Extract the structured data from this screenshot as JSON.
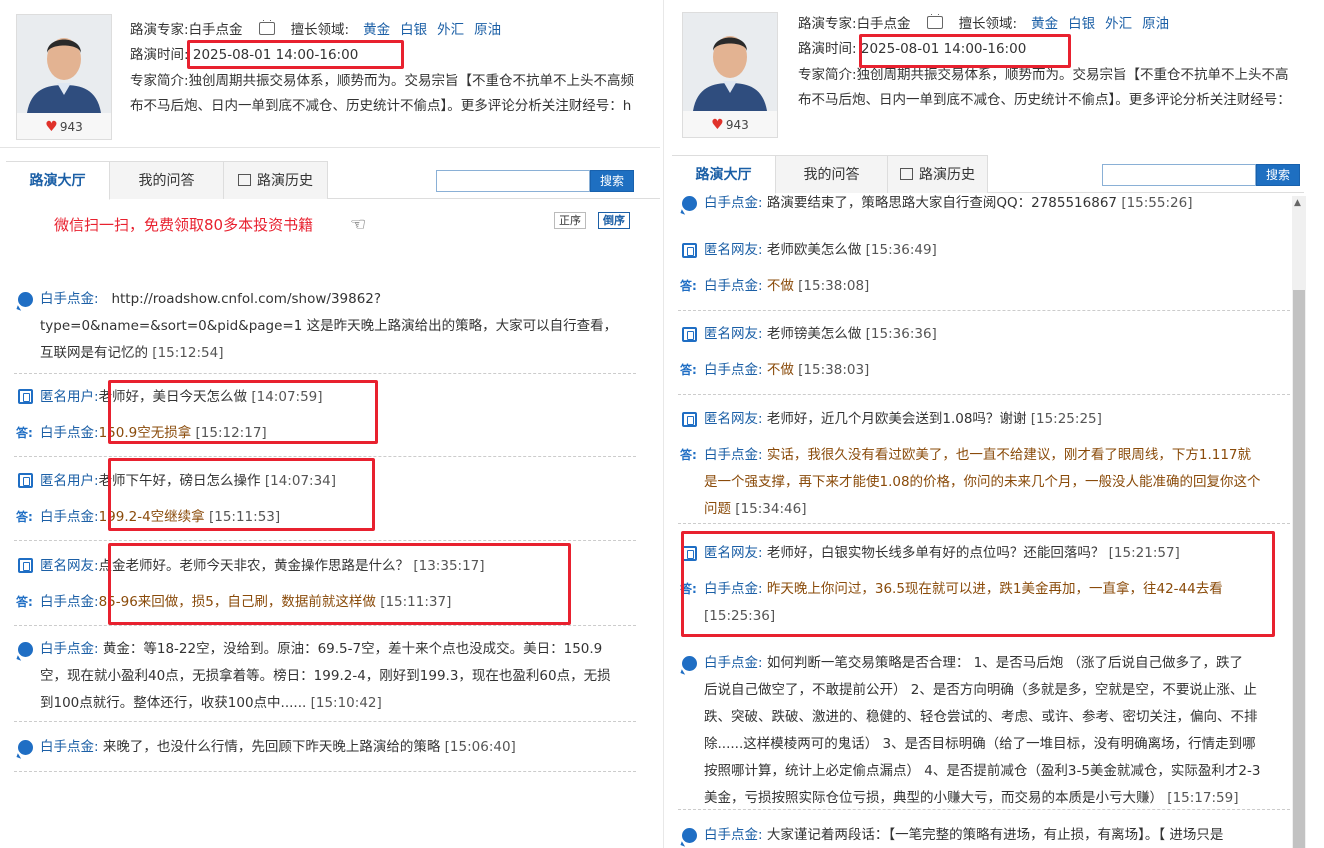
{
  "left": {
    "profile": {
      "expert_label": "路演专家:",
      "expert_name": "白手点金",
      "field_label": "擅长领域:",
      "fields": [
        "黄金",
        "白银",
        "外汇",
        "原油"
      ],
      "time_label": "路演时间:",
      "time_value": "2025-08-01 14:00-16:00",
      "intro_label": "专家简介:",
      "intro_line1": "独创周期共振交易体系，顺势而为。交易宗旨【不重仓不抗单不上头不高频",
      "intro_line2": "布不马后炮、日内一单到底不减仓、历史统计不偷点】。更多评论分析关注财经号：h",
      "likes": "943"
    },
    "tabs": [
      "路演大厅",
      "我的问答",
      "路演历史"
    ],
    "search_button": "搜索",
    "promo": "微信扫一扫，免费领取80多本投资书籍",
    "sort": [
      "正序",
      "倒序"
    ],
    "items": [
      {
        "type": "post",
        "name": "白手点金:",
        "text": "http://roadshow.cnfol.com/show/39862?",
        "text2": "type=0&name=&sort=0&pid&page=1 这是昨天晚上路演给出的策略，大家可以自行查看，",
        "text3": "互联网是有记忆的",
        "time": "[15:12:54]"
      },
      {
        "type": "qa",
        "qname": "匿名用户:",
        "q": "老师好，美日今天怎么做",
        "qtime": "[14:07:59]",
        "aname": "白手点金:",
        "a": "150.9空无损拿",
        "atime": "[15:12:17]"
      },
      {
        "type": "qa",
        "qname": "匿名用户:",
        "q": "老师下午好，磅日怎么操作",
        "qtime": "[14:07:34]",
        "aname": "白手点金:",
        "a": "199.2-4空继续拿",
        "atime": "[15:11:53]"
      },
      {
        "type": "qa",
        "qname": "匿名网友:",
        "q": "点金老师好。老师今天非农，黄金操作思路是什么？",
        "qtime": "[13:35:17]",
        "aname": "白手点金:",
        "a": "85-96来回做，损5，自己刷，数据前就这样做",
        "atime": "[15:11:37]"
      },
      {
        "type": "post",
        "name": "白手点金:",
        "text": "黄金：等18-22空，没给到。原油：69.5-7空，差十来个点也没成交。美日：150.9",
        "text2": "空，现在就小盈利40点，无损拿着等。榜日：199.2-4，刚好到199.3，现在也盈利60点，无损",
        "text3": "到100点就行。整体还行，收获100点中......",
        "time": "[15:10:42]"
      },
      {
        "type": "post",
        "name": "白手点金:",
        "text": "来晚了，也没什么行情，先回顾下昨天晚上路演给的策略",
        "time": "[15:06:40]"
      }
    ]
  },
  "right": {
    "profile": {
      "expert_label": "路演专家:",
      "expert_name": "白手点金",
      "field_label": "擅长领域:",
      "fields": [
        "黄金",
        "白银",
        "外汇",
        "原油"
      ],
      "time_label": "路演时间:",
      "time_value": "2025-08-01 14:00-16:00",
      "intro_label": "专家简介:",
      "intro_line1": "独创周期共振交易体系，顺势而为。交易宗旨【不重仓不抗单不上头不高",
      "intro_line2": "布不马后炮、日内一单到底不减仓、历史统计不偷点】。更多评论分析关注财经号：",
      "likes": "943"
    },
    "tabs": [
      "路演大厅",
      "我的问答",
      "路演历史"
    ],
    "search_button": "搜索",
    "items": [
      {
        "type": "post",
        "name": "白手点金:",
        "text": "路演要结束了，策略思路大家自行查阅QQ：2785516867",
        "time": "[15:55:26]"
      },
      {
        "type": "qa",
        "qname": "匿名网友:",
        "q": "老师欧美怎么做",
        "qtime": "[15:36:49]",
        "aname": "白手点金:",
        "a": "不做",
        "atime": "[15:38:08]"
      },
      {
        "type": "qa",
        "qname": "匿名网友:",
        "q": "老师镑美怎么做",
        "qtime": "[15:36:36]",
        "aname": "白手点金:",
        "a": "不做",
        "atime": "[15:38:03]"
      },
      {
        "type": "qa",
        "qname": "匿名网友:",
        "q": "老师好，近几个月欧美会送到1.08吗？谢谢",
        "qtime": "[15:25:25]",
        "aname": "白手点金:",
        "a": "实话，我很久没有看过欧美了，也一直不给建议，刚才看了眼周线，下方1.117就",
        "a2": "是一个强支撑，再下来才能使1.08的价格，你问的未来几个月，一般没人能准确的回复你这个",
        "a3": "问题",
        "atime": "[15:34:46]"
      },
      {
        "type": "qa",
        "qname": "匿名网友:",
        "q": "老师好，白银实物长线多单有好的点位吗？还能回落吗？",
        "qtime": "[15:21:57]",
        "aname": "白手点金:",
        "a": "昨天晚上你问过，36.5现在就可以进，跌1美金再加，一直拿，往42-44去看",
        "a2": "",
        "atime": "[15:25:36]"
      },
      {
        "type": "post",
        "name": "白手点金:",
        "text": "如何判断一笔交易策略是否合理： 1、是否马后炮 （涨了后说自己做多了，跌了",
        "text2": "后说自己做空了，不敢提前公开） 2、是否方向明确（多就是多，空就是空，不要说止涨、止",
        "text3": "跌、突破、跌破、激进的、稳健的、轻仓尝试的、考虑、或许、参考、密切关注，偏向、不排",
        "text4": "除......这样模棱两可的鬼话） 3、是否目标明确（给了一堆目标，没有明确离场，行情走到哪",
        "text5": "按照哪计算，统计上必定偷点漏点） 4、是否提前减仓（盈利3-5美金就减仓，实际盈利才2-3",
        "text6": "美金，亏损按照实际仓位亏损，典型的小赚大亏，而交易的本质是小亏大赚）",
        "time": "[15:17:59]"
      },
      {
        "type": "post",
        "name": "白手点金:",
        "text": "大家谨记着两段话：【一笔完整的策略有进场，有止损，有离场】。【 进场只是",
        "time": ""
      }
    ]
  }
}
